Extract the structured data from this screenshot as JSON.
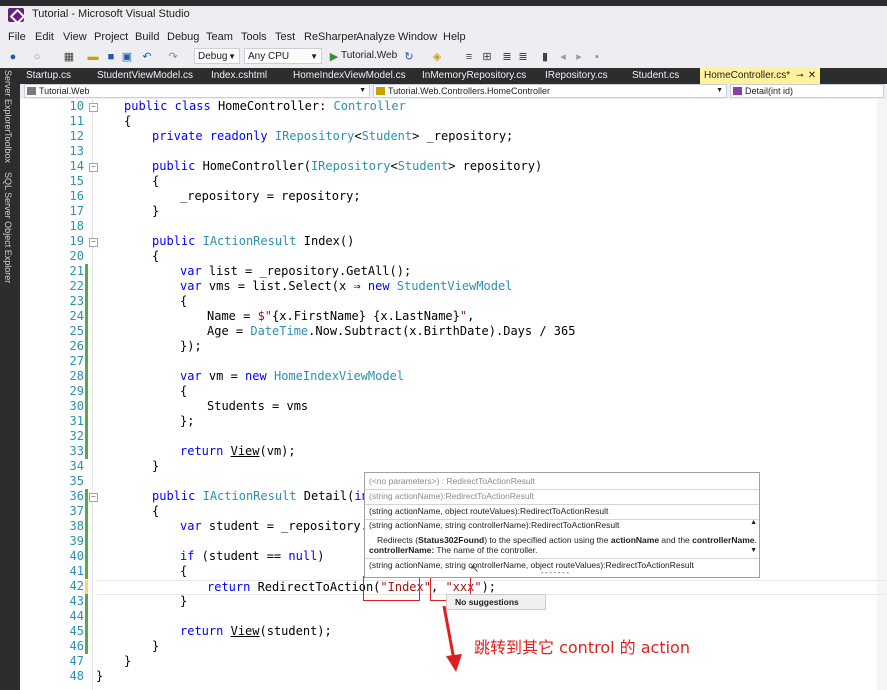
{
  "window": {
    "title": "Tutorial - Microsoft Visual Studio"
  },
  "menu": [
    "File",
    "Edit",
    "View",
    "Project",
    "Build",
    "Debug",
    "Team",
    "Tools",
    "Test",
    "ReSharper",
    "Analyze",
    "Window",
    "Help"
  ],
  "toolbar": {
    "config": "Debug",
    "platform": "Any CPU",
    "start_target": "Tutorial.Web",
    "icons": [
      "back-icon",
      "forward-icon",
      "new-project-icon",
      "open-icon",
      "save-icon",
      "save-all-icon",
      "undo-icon",
      "redo-icon",
      "play-icon",
      "refresh-icon",
      "browse-icon",
      "bookmark-icon"
    ]
  },
  "side_tabs": [
    "Server Explorer",
    "Toolbox",
    "SQL Server Object Explorer"
  ],
  "doc_tabs": [
    {
      "label": "Startup.cs"
    },
    {
      "label": "StudentViewModel.cs"
    },
    {
      "label": "Index.cshtml"
    },
    {
      "label": "HomeIndexViewModel.cs"
    },
    {
      "label": "InMemoryRepository.cs"
    },
    {
      "label": "IRepository.cs"
    },
    {
      "label": "Student.cs"
    },
    {
      "label": "HomeController.cs*",
      "active": true
    }
  ],
  "navbar": {
    "project": "Tutorial.Web",
    "type": "Tutorial.Web.Controllers.HomeController",
    "member": "Detail(int id)"
  },
  "line_numbers": [
    "10",
    "11",
    "12",
    "13",
    "14",
    "15",
    "16",
    "17",
    "18",
    "19",
    "20",
    "21",
    "22",
    "23",
    "24",
    "25",
    "26",
    "27",
    "28",
    "29",
    "30",
    "31",
    "32",
    "33",
    "34",
    "35",
    "36",
    "37",
    "38",
    "39",
    "40",
    "41",
    "42",
    "43",
    "44",
    "45",
    "46",
    "47",
    "48"
  ],
  "code": {
    "l10": [
      "public",
      " ",
      "class",
      " HomeController: ",
      "Controller"
    ],
    "l11": "{",
    "l12": [
      "private",
      " ",
      "readonly",
      " ",
      "IRepository",
      "<",
      "Student",
      "> _repository;"
    ],
    "l14": [
      "public",
      " HomeController(",
      "IRepository",
      "<",
      "Student",
      "> repository)"
    ],
    "l15": "{",
    "l16": "_repository = repository;",
    "l17": "}",
    "l19": [
      "public",
      " ",
      "IActionResult",
      " Index()"
    ],
    "l20": "{",
    "l21": [
      "var",
      " list = _repository.GetAll();"
    ],
    "l22": [
      "var",
      " vms = list.Select(x ",
      "⇒",
      " ",
      "new",
      " ",
      "StudentViewModel"
    ],
    "l23": "{",
    "l24": [
      "Name = ",
      "$\"",
      "{x.FirstName} {x.LastName}",
      "\"",
      ","
    ],
    "l25": [
      "Age = ",
      "DateTime",
      ".Now.Subtract(x.BirthDate).Days / 365"
    ],
    "l26": "});",
    "l28": [
      "var",
      " vm = ",
      "new",
      " ",
      "HomeIndexViewModel"
    ],
    "l29": "{",
    "l30": "Students = vms",
    "l31": "};",
    "l33": [
      "return",
      " ",
      "View",
      "(vm);"
    ],
    "l34": "}",
    "l36": [
      "public",
      " ",
      "IActionResult",
      " Detail(",
      "int"
    ],
    "l37": "{",
    "l38": [
      "var",
      " student = _repository.G"
    ],
    "l40": [
      "if",
      " (student ",
      "==",
      " ",
      "null",
      ")"
    ],
    "l41": "{",
    "l42": [
      "return",
      " RedirectToAction(",
      "\"Index\"",
      ", ",
      "\"xxx\"",
      ");"
    ],
    "l43": "}",
    "l45": [
      "return",
      " ",
      "View",
      "(student);"
    ],
    "l46": "}",
    "l47": "}",
    "l48": "}"
  },
  "popup": {
    "rows": [
      "(<no parameters>) : RedirectToActionResult",
      "(string actionName):RedirectToActionResult",
      "(string actionName, object routeValues):RedirectToActionResult",
      "(string actionName, string controllerName):RedirectToActionResult",
      "(string actionName, string controllerName, object routeValues):RedirectToActionResult"
    ],
    "desc_prefix": "Redirects (",
    "desc_status": "Status302Found",
    "desc_mid": ") to the specified action using the ",
    "desc_action": "actionName",
    "desc_and": " and the ",
    "desc_controller": "controllerName",
    "desc_end": ".",
    "param_name": "controllerName:",
    "param_desc": " The name of the controller.",
    "dashes": "- - - - - - -",
    "no_suggestions": "No suggestions"
  },
  "annotation": "跳转到其它 control 的 action",
  "colors": {
    "keyword": "#0000ff",
    "type": "#2b91af",
    "string": "#a31515",
    "annotation": "#e02020",
    "active_tab": "#fff29d"
  }
}
